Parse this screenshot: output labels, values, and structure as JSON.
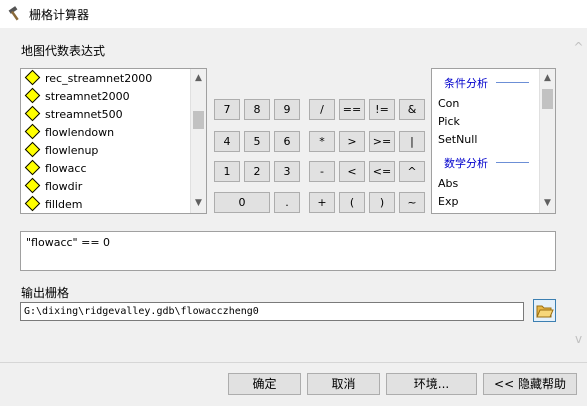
{
  "window": {
    "title": "栅格计算器"
  },
  "expression_section": {
    "label": "地图代数表达式"
  },
  "layers": {
    "items": [
      "rec_streamnet2000",
      "streamnet2000",
      "streamnet500",
      "flowlendown",
      "flowlenup",
      "flowacc",
      "flowdir",
      "filldem"
    ]
  },
  "calculator": {
    "row1": [
      "7",
      "8",
      "9",
      "/",
      "==",
      "!=",
      "&"
    ],
    "row2": [
      "4",
      "5",
      "6",
      "*",
      ">",
      ">=",
      "|"
    ],
    "row3": [
      "1",
      "2",
      "3",
      "-",
      "<",
      "<=",
      "^"
    ],
    "row4": [
      "0",
      ".",
      "+",
      "(",
      ")",
      "~"
    ]
  },
  "functions": {
    "group1_title": "条件分析",
    "group1_items": [
      "Con",
      "Pick",
      "SetNull"
    ],
    "group2_title": "数学分析",
    "group2_items": [
      "Abs",
      "Exp"
    ]
  },
  "expression": {
    "value": "\"flowacc\" == 0"
  },
  "output": {
    "label": "输出栅格",
    "value": "G:\\dixing\\ridgevalley.gdb\\flowacczheng0"
  },
  "buttons": {
    "ok": "确定",
    "cancel": "取消",
    "env": "环境...",
    "hide_help": "<< 隐藏帮助"
  },
  "icons": {
    "scroll_up": "▲",
    "scroll_down": "▼",
    "outer_up": "^",
    "outer_down": "v"
  }
}
